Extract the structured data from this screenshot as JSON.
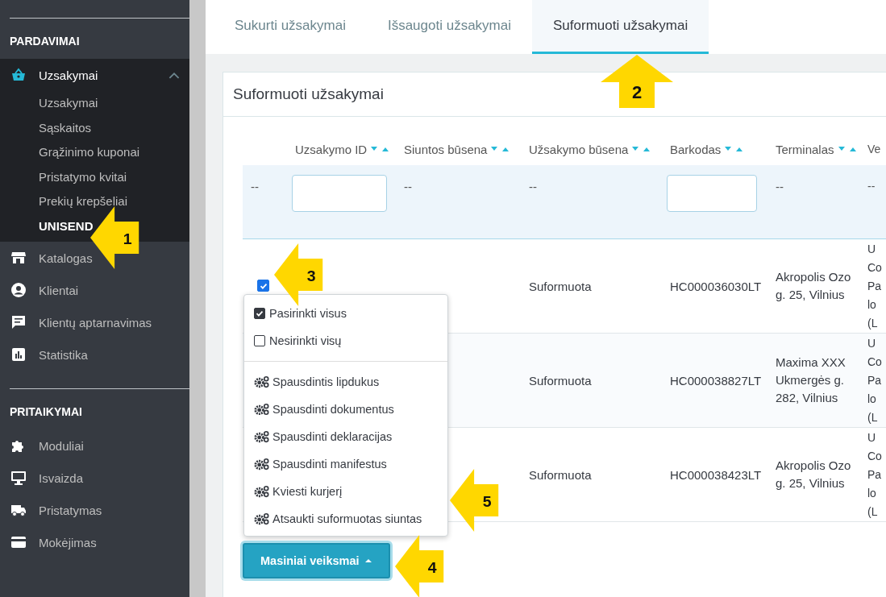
{
  "sidebar": {
    "sections": [
      {
        "title": "PARDAVIMAI",
        "items": [
          {
            "label": "Uzsakymai",
            "expanded": true,
            "children": [
              {
                "label": "Uzsakymai",
                "selected": false
              },
              {
                "label": "Sąskaitos",
                "selected": false
              },
              {
                "label": "Grąžinimo kuponai",
                "selected": false
              },
              {
                "label": "Pristatymo kvitai",
                "selected": false
              },
              {
                "label": "Prekių krepšeliai",
                "selected": false
              },
              {
                "label": "UNISEND",
                "selected": true
              }
            ]
          },
          {
            "label": "Katalogas",
            "expanded": false
          },
          {
            "label": "Klientai",
            "expanded": false
          },
          {
            "label": "Klientų aptarnavimas",
            "expanded": false
          },
          {
            "label": "Statistika",
            "expanded": false
          }
        ]
      },
      {
        "title": "PRITAIKYMAI",
        "items": [
          {
            "label": "Moduliai",
            "expanded": false
          },
          {
            "label": "Isvaizda",
            "expanded": false
          },
          {
            "label": "Pristatymas",
            "expanded": false
          },
          {
            "label": "Mokėjimas",
            "expanded": false
          }
        ]
      }
    ]
  },
  "tabs": [
    {
      "label": "Sukurti užsakymai",
      "selected": false
    },
    {
      "label": "Išsaugoti užsakymai",
      "selected": false
    },
    {
      "label": "Suformuoti užsakymai",
      "selected": true
    }
  ],
  "panel": {
    "title": "Suformuoti užsakymai",
    "table": {
      "columns": [
        "Uzsakymo ID",
        "Siuntos būsena",
        "Užsakymo būsena",
        "Barkodas",
        "Terminalas",
        "Ve"
      ],
      "filters": [
        {
          "kind": "text",
          "value": "--"
        },
        {
          "kind": "input"
        },
        {
          "kind": "text",
          "value": "--"
        },
        {
          "kind": "text",
          "value": "--"
        },
        {
          "kind": "input"
        },
        {
          "kind": "text",
          "value": "--"
        },
        {
          "kind": "text",
          "value": "--"
        }
      ],
      "rows": [
        {
          "checked": true,
          "order_status": "Suformuota",
          "barcode": "HC000036030LT",
          "terminal": "Akropolis Ozo g. 25, Vilnius",
          "column_7": [
            "U",
            "Co",
            "Pa",
            "lo",
            "(L"
          ]
        },
        {
          "order_status": "Suformuota",
          "barcode": "HC000038827LT",
          "terminal": "Maxima XXX Ukmergės g. 282, Vilnius",
          "column_7": [
            "U",
            "Co",
            "Pa",
            "lo",
            "(L"
          ]
        },
        {
          "order_status": "Suformuota",
          "barcode": "HC000038423LT",
          "terminal": "Akropolis Ozo g. 25, Vilnius",
          "column_7": [
            "U",
            "Co",
            "Pa",
            "lo",
            "(L"
          ]
        }
      ]
    },
    "bulk_menu": {
      "items": [
        {
          "kind": "checkbox",
          "label": "Pasirinkti visus",
          "checked": true
        },
        {
          "kind": "checkbox",
          "label": "Nesirinkti visų",
          "checked": false
        },
        {
          "kind": "action",
          "label": "Spausdintis lipdukus"
        },
        {
          "kind": "action",
          "label": "Spausdinti dokumentus"
        },
        {
          "kind": "action",
          "label": "Spausdinti deklaracijas"
        },
        {
          "kind": "action",
          "label": "Spausdinti manifestus"
        },
        {
          "kind": "action",
          "label": "Kviesti kurjerį"
        },
        {
          "kind": "action",
          "label": "Atsaukti suformuotas siuntas"
        }
      ]
    },
    "bulk_button": {
      "label": "Masiniai veiksmai",
      "expanded": true
    }
  },
  "callouts": [
    "1",
    "2",
    "3",
    "4",
    "5"
  ]
}
